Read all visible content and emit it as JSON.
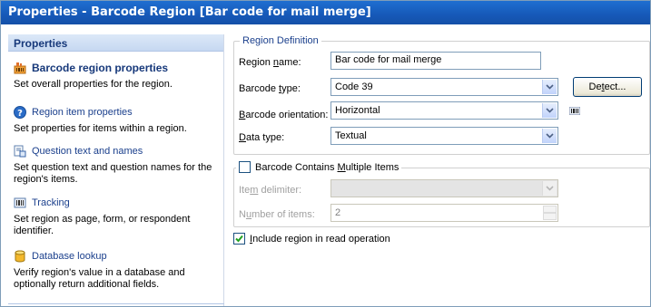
{
  "window": {
    "title": "Properties - Barcode Region [Bar code for mail merge]"
  },
  "sidebar": {
    "header": "Properties",
    "items": [
      {
        "label": "Barcode region properties",
        "description": "Set overall properties for the region.",
        "icon": "barcode-region-icon",
        "active": true
      },
      {
        "label": "Region item properties",
        "description": "Set properties for items within a region.",
        "icon": "help-circle-icon",
        "active": false
      },
      {
        "label": "Question text and names",
        "description": "Set question text and question names for the region's items.",
        "icon": "question-text-icon",
        "active": false
      },
      {
        "label": "Tracking",
        "description": "Set region as page, form, or respondent identifier.",
        "icon": "tracking-icon",
        "active": false
      },
      {
        "label": "Database lookup",
        "description": "Verify region's value in a database and optionally return additional fields.",
        "icon": "database-icon",
        "active": false
      }
    ]
  },
  "region_definition": {
    "legend": "Region Definition",
    "name_label_pre": "Region ",
    "name_label_u": "n",
    "name_label_post": "ame:",
    "name_value": "Bar code for mail merge",
    "type_label_pre": "Barcode ",
    "type_label_u": "t",
    "type_label_post": "ype:",
    "type_value": "Code 39",
    "detect_label_pre": "De",
    "detect_label_u": "t",
    "detect_label_post": "ect...",
    "orientation_label_pre": "",
    "orientation_label_u": "B",
    "orientation_label_post": "arcode orientation:",
    "orientation_value": "Horizontal",
    "datatype_label_pre": "",
    "datatype_label_u": "D",
    "datatype_label_post": "ata type:",
    "datatype_value": "Textual"
  },
  "multiple_items": {
    "checkbox_label_pre": "Barcode Contains ",
    "checkbox_label_u": "M",
    "checkbox_label_post": "ultiple Items",
    "checked": false,
    "delimiter_label_pre": "Ite",
    "delimiter_label_u": "m",
    "delimiter_label_post": " delimiter:",
    "delimiter_value": "",
    "count_label_pre": "N",
    "count_label_u": "u",
    "count_label_post": "mber of items:",
    "count_value": "2"
  },
  "include_read": {
    "label_pre": "",
    "label_u": "I",
    "label_post": "nclude region in read operation",
    "checked": true
  },
  "colors": {
    "title_bar": "#1659b8",
    "sidebar_header": "#c6d8f1",
    "link": "#1a3f8c"
  }
}
